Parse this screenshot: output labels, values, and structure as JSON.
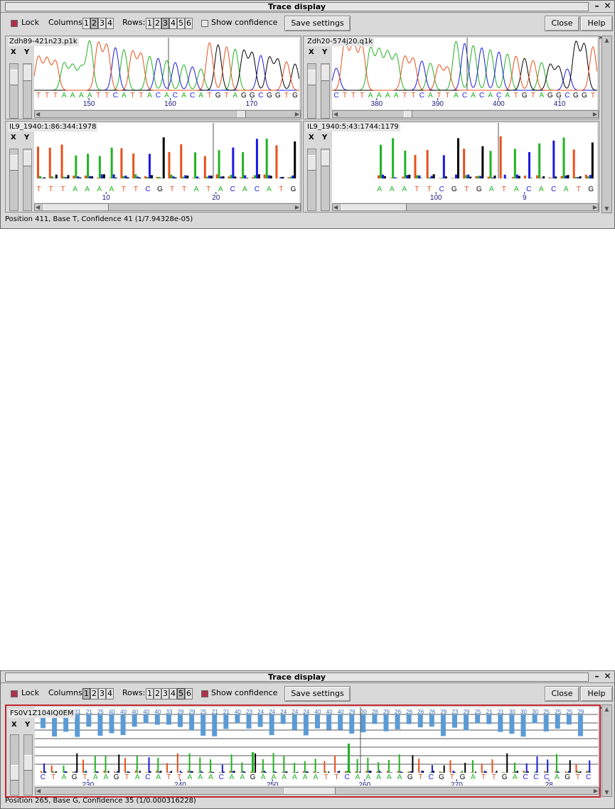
{
  "window1": {
    "title": "Trace display",
    "lock_label": "Lock",
    "columns_label": "Columns:",
    "columns": [
      "1",
      "2",
      "3",
      "4"
    ],
    "rows_label": "Rows:",
    "rows": [
      "1",
      "2",
      "3",
      "4",
      "5",
      "6"
    ],
    "show_confidence_label": "Show confidence",
    "save_settings_label": "Save settings",
    "close_label": "Close",
    "help_label": "Help >>",
    "minimize_glyph": "–",
    "close_glyph": "✕",
    "axis_x": "X",
    "axis_y": "Y",
    "panels": [
      {
        "title": "Zdh89-421n23.p1k",
        "bases": "TTTAAAATTCATTACACACATGTAGGCGGTG",
        "ticks": [
          "150",
          "160",
          "170"
        ]
      },
      {
        "title": "Zdh20-574j20.q1k",
        "bases": "CTTTAAAATTCATTACACACATGTAGGCGGT",
        "ticks": [
          "380",
          "390",
          "400",
          "410"
        ]
      },
      {
        "title": "IL9_1940:1:86:344:1978",
        "bases": "TTTAAAATTCGTTATACACATG",
        "ticks": [
          "10",
          "20"
        ]
      },
      {
        "title": "IL9_1940:5:43:1744:1179",
        "bases": "AAATTCGTGATACACATG",
        "ticks": [
          "100",
          "9"
        ]
      }
    ],
    "status": "Position   411, Base T, Confidence   41  (1/7.94328e-05)"
  },
  "window2": {
    "title": "Trace display",
    "lock_label": "Lock",
    "columns_label": "Columns:",
    "columns": [
      "1",
      "2",
      "3",
      "4"
    ],
    "rows_label": "Rows:",
    "rows": [
      "1",
      "2",
      "3",
      "4",
      "5",
      "6"
    ],
    "show_confidence_label": "Show confidence",
    "save_settings_label": "Save settings",
    "close_label": "Close",
    "help_label": "Help >>",
    "minimize_glyph": "–",
    "close_glyph": "✕",
    "axis_x": "X",
    "axis_y": "Y",
    "panel": {
      "title": "FS0V1Z104IQ0EM",
      "bases": "CTAGTAAGTACATTAAACAAGAAAAAATTCAAAAAGTCGTGATTGACCCAGTC",
      "ticks": [
        "230",
        "240",
        "250",
        "260",
        "270",
        "28"
      ],
      "confidence_labels": [
        "32",
        "33",
        "30",
        "31",
        "21",
        "25",
        "40",
        "40",
        "40",
        "40",
        "40",
        "33",
        "29",
        "29",
        "25",
        "21",
        "21",
        "40",
        "23",
        "24",
        "24",
        "24",
        "24",
        "24",
        "40",
        "40",
        "40",
        "29",
        "30",
        "28",
        "29",
        "26",
        "26",
        "26",
        "26",
        "29",
        "23",
        "29",
        "25",
        "21",
        "21",
        "30",
        "30",
        "30",
        "25",
        "25",
        "25",
        "29"
      ]
    },
    "status": "Position   265, Base G, Confidence   35  (1/0.000316228)"
  },
  "colors": {
    "A": "#22b222",
    "C": "#1a1adf",
    "G": "#000000",
    "T": "#e8501a",
    "confidence": "#5b9bd5",
    "selected_border": "#c0282e",
    "lock_checked": "#b0304a"
  }
}
